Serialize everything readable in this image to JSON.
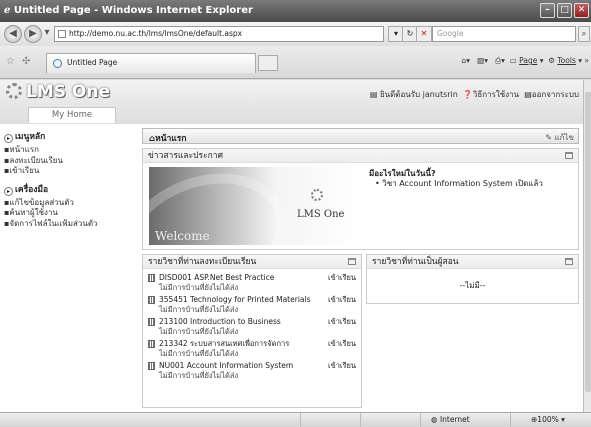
{
  "window": {
    "title": "Untitled Page - Windows Internet Explorer"
  },
  "toolbar": {
    "address": "http://demo.nu.ac.th/lms/lmsOne/default.aspx",
    "search_placeholder": "Google",
    "tab_title": "Untitled Page",
    "page_menu": "Page",
    "tools_menu": "Tools"
  },
  "site": {
    "logo": "LMS One",
    "home_tab": "My Home",
    "welcome": "ยินดีต้อนรับ janutsrin",
    "help": "วิธีการใช้งาน",
    "logout": "ออกจากระบบ"
  },
  "sidebar": {
    "main_menu": "เมนูหลัก",
    "main_items": [
      "หน้าแรก",
      "ลงทะเบียนเรียน",
      "เข้าเรียน"
    ],
    "tools_menu": "เครื่องมือ",
    "tools_items": [
      "แก้ไขข้อมูลส่วนตัว",
      "ค้นหาผู้ใช้งาน",
      "จัดการไฟล์ในแฟ้มส่วนตัว"
    ]
  },
  "main": {
    "page_title": "หน้าแรก",
    "edit_label": "แก้ไข",
    "news_panel_title": "ข่าวสารและประกาศ",
    "hero_welcome": "Welcome",
    "hero_brand": "LMS One",
    "news_question": "มีอะไรใหม่ในวันนี้?",
    "news_items": [
      "วิชา Account Information System เปิดแล้ว"
    ],
    "enrolled_title": "รายวิชาที่ท่านลงทะเบียนเรียน",
    "teaching_title": "รายวิชาที่ท่านเป็นผู้สอน",
    "teaching_empty": "--ไม่มี--",
    "courses": [
      {
        "name": "DISD001 ASP.Net Best Practice",
        "status": "ไม่มีการบ้านที่ยังไม่ได้ส่ง",
        "action": "เข้าเรียน"
      },
      {
        "name": "355451 Technology for Printed Materials",
        "status": "ไม่มีการบ้านที่ยังไม่ได้ส่ง",
        "action": "เข้าเรียน"
      },
      {
        "name": "213100 Introduction to Business",
        "status": "ไม่มีการบ้านที่ยังไม่ได้ส่ง",
        "action": "เข้าเรียน"
      },
      {
        "name": "213342 ระบบสารสนเทศเพื่อการจัดการ",
        "status": "ไม่มีการบ้านที่ยังไม่ได้ส่ง",
        "action": "เข้าเรียน"
      },
      {
        "name": "NU001 Account Information System",
        "status": "ไม่มีการบ้านที่ยังไม่ได้ส่ง",
        "action": "เข้าเรียน"
      }
    ]
  },
  "statusbar": {
    "zone": "Internet",
    "zoom": "100%"
  }
}
